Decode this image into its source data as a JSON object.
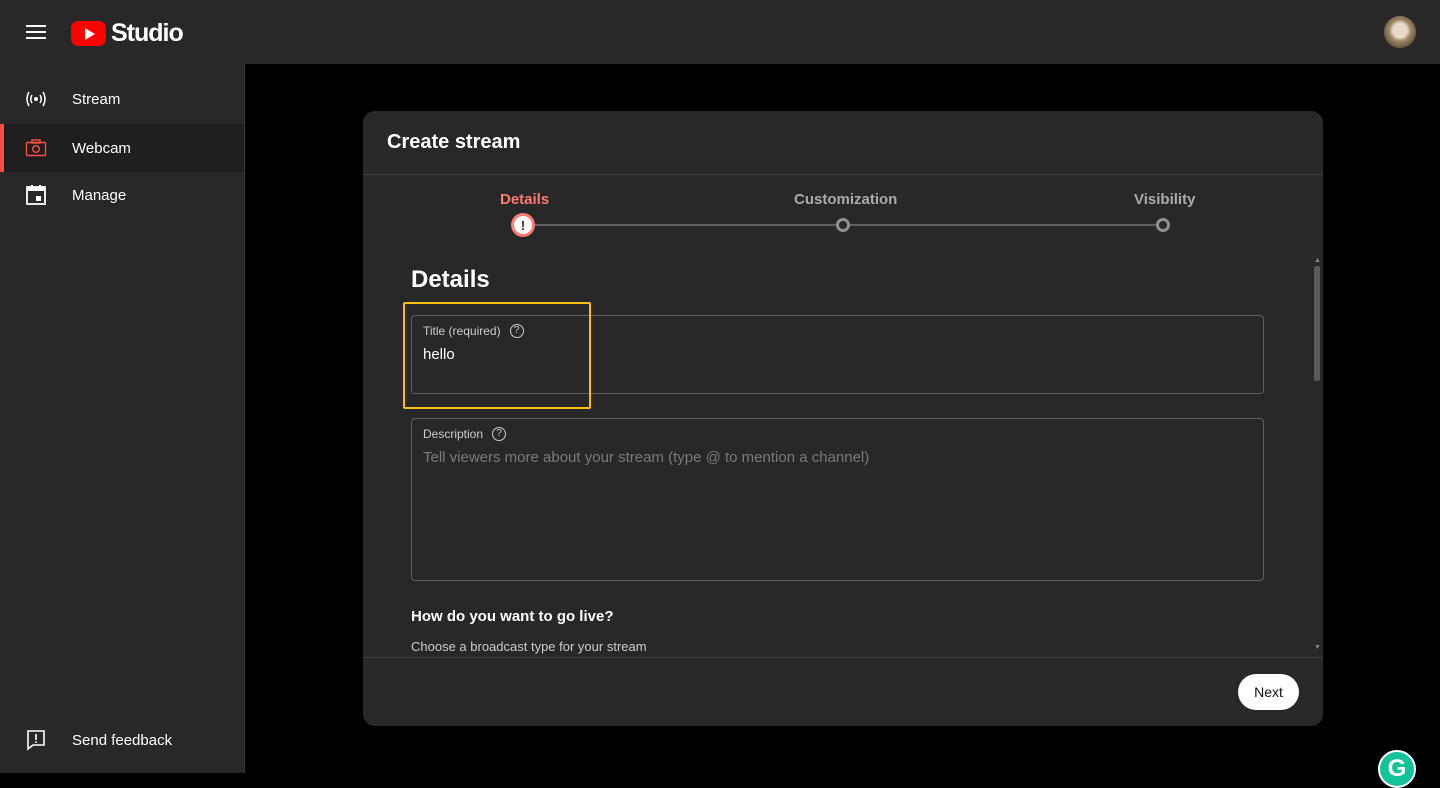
{
  "header": {
    "logo_text": "Studio"
  },
  "sidebar": {
    "items": [
      {
        "label": "Stream"
      },
      {
        "label": "Webcam"
      },
      {
        "label": "Manage"
      }
    ],
    "feedback_label": "Send feedback"
  },
  "modal": {
    "title": "Create stream",
    "steps": [
      {
        "label": "Details",
        "state": "current"
      },
      {
        "label": "Customization",
        "state": "pending"
      },
      {
        "label": "Visibility",
        "state": "pending"
      }
    ],
    "section_heading": "Details",
    "title_field": {
      "label": "Title (required)",
      "value": "hello"
    },
    "description_field": {
      "label": "Description",
      "placeholder": "Tell viewers more about your stream (type @ to mention a channel)"
    },
    "golive": {
      "title": "How do you want to go live?",
      "subtitle": "Choose a broadcast type for your stream"
    },
    "next_label": "Next"
  },
  "colors": {
    "accent": "#ff4e45",
    "highlight": "#f7c00a",
    "brand_red": "#ff0000"
  }
}
